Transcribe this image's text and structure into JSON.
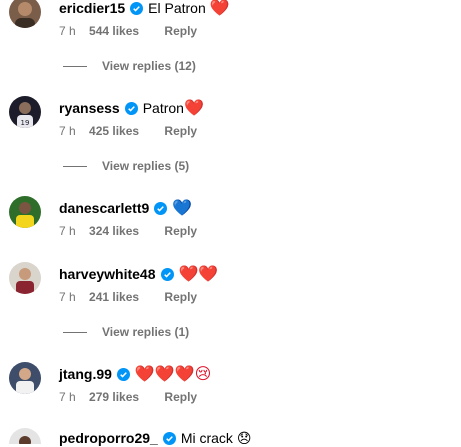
{
  "comments": [
    {
      "username": "ericdier15",
      "text": "El Patron",
      "emoji": "❤️",
      "time": "7 h",
      "likes": "544 likes",
      "reply": "Reply",
      "view_replies": "View replies (12)"
    },
    {
      "username": "ryansess",
      "text": "Patron",
      "emoji": "❤️",
      "time": "7 h",
      "likes": "425 likes",
      "reply": "Reply",
      "view_replies": "View replies (5)"
    },
    {
      "username": "danescarlett9",
      "text": "",
      "emoji": "💙",
      "time": "7 h",
      "likes": "324 likes",
      "reply": "Reply"
    },
    {
      "username": "harveywhite48",
      "text": "",
      "emoji": "❤️❤️",
      "time": "7 h",
      "likes": "241 likes",
      "reply": "Reply",
      "view_replies": "View replies (1)"
    },
    {
      "username": "jtang.99",
      "text": "",
      "emoji": "❤️❤️❤️😢",
      "time": "7 h",
      "likes": "279 likes",
      "reply": "Reply"
    },
    {
      "username": "pedroporro29_",
      "text": "Mi crack",
      "emoji": "😞"
    }
  ],
  "colors": {
    "verified": "#0095f6",
    "meta": "#737373",
    "heart": "#e0142a"
  }
}
